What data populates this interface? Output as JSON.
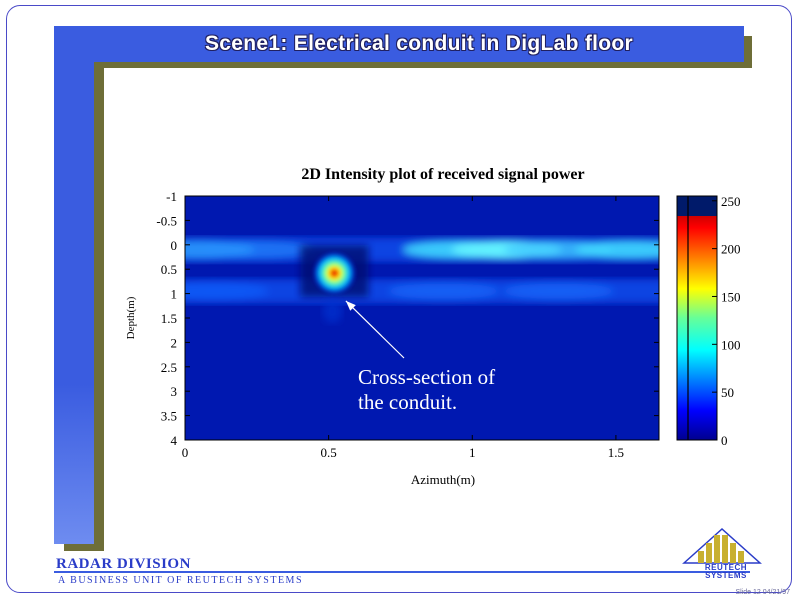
{
  "slide": {
    "title": "Scene1: Electrical conduit in DigLab floor",
    "division": "RADAR DIVISION",
    "business_unit": "A BUSINESS UNIT OF REUTECH SYSTEMS",
    "logo_text_1": "REUTECH",
    "logo_text_2": "SYSTEMS",
    "slide_number": "Slide 12 04/21/97"
  },
  "colors": {
    "accent_blue": "#3a5ce0",
    "shadow_olive": "#6e6e38",
    "logo_gold": "#c8b030"
  },
  "chart_data": {
    "type": "heatmap",
    "title": "2D Intensity plot of received signal power",
    "xlabel": "Azimuth(m)",
    "ylabel": "Depth(m)",
    "xlim": [
      0,
      1.65
    ],
    "ylim": [
      -1,
      4
    ],
    "y_inverted": true,
    "x_ticks": [
      {
        "value": 0,
        "label": "0"
      },
      {
        "value": 0.5,
        "label": "0.5"
      },
      {
        "value": 1,
        "label": "1"
      },
      {
        "value": 1.5,
        "label": "1.5"
      }
    ],
    "y_ticks": [
      {
        "value": -1,
        "label": "-1"
      },
      {
        "value": -0.5,
        "label": "-0.5"
      },
      {
        "value": 0,
        "label": "0"
      },
      {
        "value": 0.5,
        "label": "0.5"
      },
      {
        "value": 1,
        "label": "1"
      },
      {
        "value": 1.5,
        "label": "1.5"
      },
      {
        "value": 2,
        "label": "2"
      },
      {
        "value": 2.5,
        "label": "2.5"
      },
      {
        "value": 3,
        "label": "3"
      },
      {
        "value": 3.5,
        "label": "3.5"
      },
      {
        "value": 4,
        "label": "4"
      }
    ],
    "colorbar": {
      "min": 0,
      "max": 255,
      "ticks": [
        {
          "value": 0,
          "label": "0"
        },
        {
          "value": 50,
          "label": "50"
        },
        {
          "value": 100,
          "label": "100"
        },
        {
          "value": 150,
          "label": "150"
        },
        {
          "value": 200,
          "label": "200"
        },
        {
          "value": 250,
          "label": "250"
        }
      ]
    },
    "features": [
      {
        "kind": "band",
        "depth": 0.1,
        "value": 95
      },
      {
        "kind": "band",
        "depth": 0.95,
        "value": 75
      },
      {
        "kind": "hotspot",
        "azimuth": 0.52,
        "depth": 0.58,
        "value": 255
      }
    ],
    "annotation": {
      "line1": "Cross-section of",
      "line2": "the conduit.",
      "target_azimuth": 0.56,
      "target_depth": 1.15
    }
  }
}
